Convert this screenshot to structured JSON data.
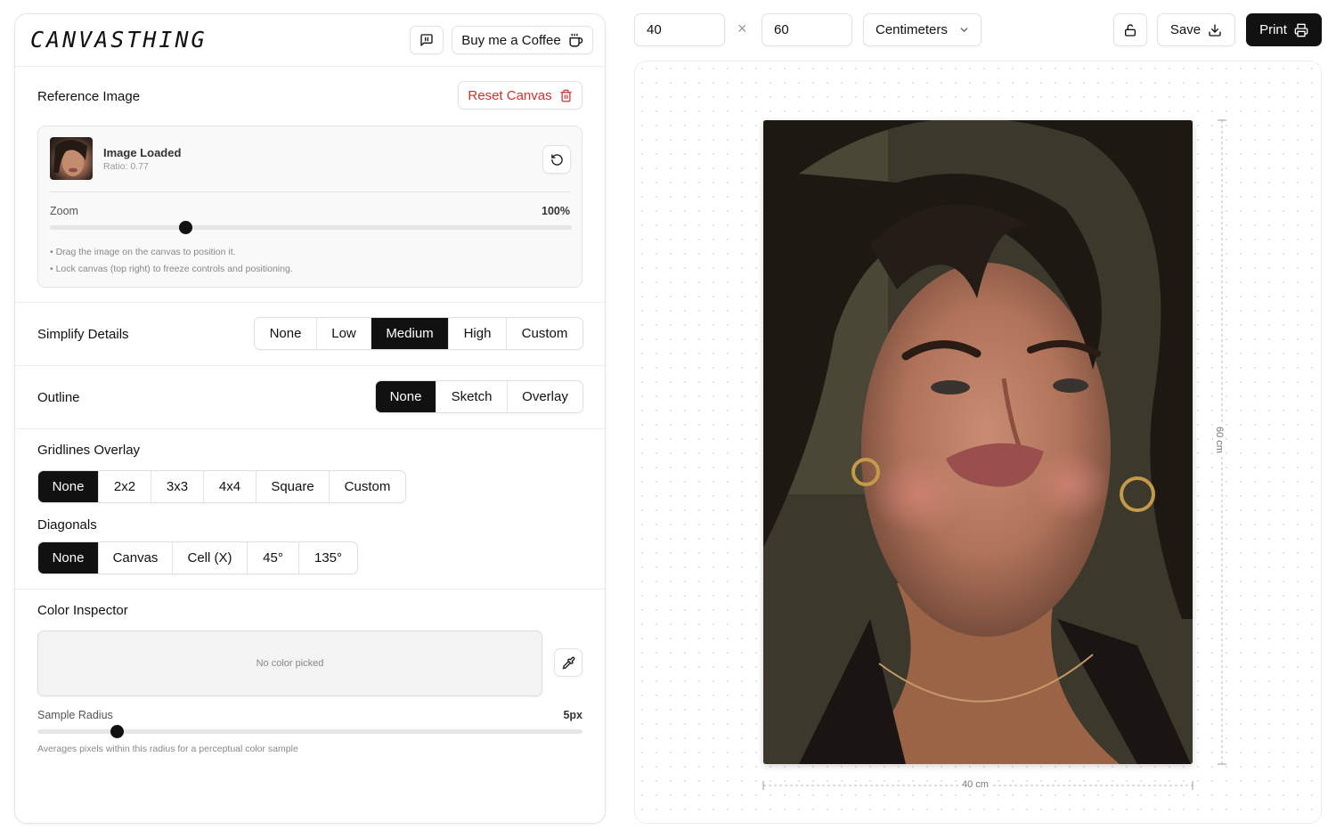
{
  "app": {
    "logo": "CANVASTHING",
    "feedback_icon": "message-square-icon",
    "coffee_button": "Buy me a Coffee",
    "coffee_icon": "coffee-cup-icon"
  },
  "reference": {
    "title": "Reference Image",
    "reset_button": "Reset Canvas",
    "reset_icon": "trash-icon",
    "image_status": "Image Loaded",
    "ratio": "Ratio: 0.77",
    "rotate_icon": "rotate-ccw-icon",
    "zoom_label": "Zoom",
    "zoom_value": "100%",
    "zoom_fraction": 0.26,
    "hint_1": "• Drag the image on the canvas to position it.",
    "hint_2": "• Lock canvas (top right) to freeze controls and positioning."
  },
  "simplify": {
    "title": "Simplify Details",
    "options": [
      "None",
      "Low",
      "Medium",
      "High",
      "Custom"
    ],
    "selected": "Medium"
  },
  "outline": {
    "title": "Outline",
    "options": [
      "None",
      "Sketch",
      "Overlay"
    ],
    "selected": "None"
  },
  "gridlines": {
    "title": "Gridlines Overlay",
    "options": [
      "None",
      "2x2",
      "3x3",
      "4x4",
      "Square",
      "Custom"
    ],
    "selected": "None"
  },
  "diagonals": {
    "title": "Diagonals",
    "options": [
      "None",
      "Canvas",
      "Cell (X)",
      "45°",
      "135°"
    ],
    "selected": "None"
  },
  "color_inspector": {
    "title": "Color Inspector",
    "empty_text": "No color picked",
    "eyedropper_icon": "pipette-icon",
    "radius_label": "Sample Radius",
    "radius_value": "5px",
    "radius_fraction": 0.147,
    "radius_hint": "Averages pixels within this radius for a perceptual color sample"
  },
  "toolbar": {
    "width": "40",
    "height": "60",
    "times_symbol": "×",
    "unit": "Centimeters",
    "chevron_icon": "chevron-down-icon",
    "lock_icon": "unlock-icon",
    "save_label": "Save",
    "save_icon": "download-icon",
    "print_label": "Print",
    "print_icon": "printer-icon"
  },
  "canvas": {
    "width_label": "40 cm",
    "height_label": "60 cm"
  },
  "colors": {
    "accent_dark": "#111111",
    "danger": "#d32f2f",
    "border": "#e2e2e2"
  }
}
